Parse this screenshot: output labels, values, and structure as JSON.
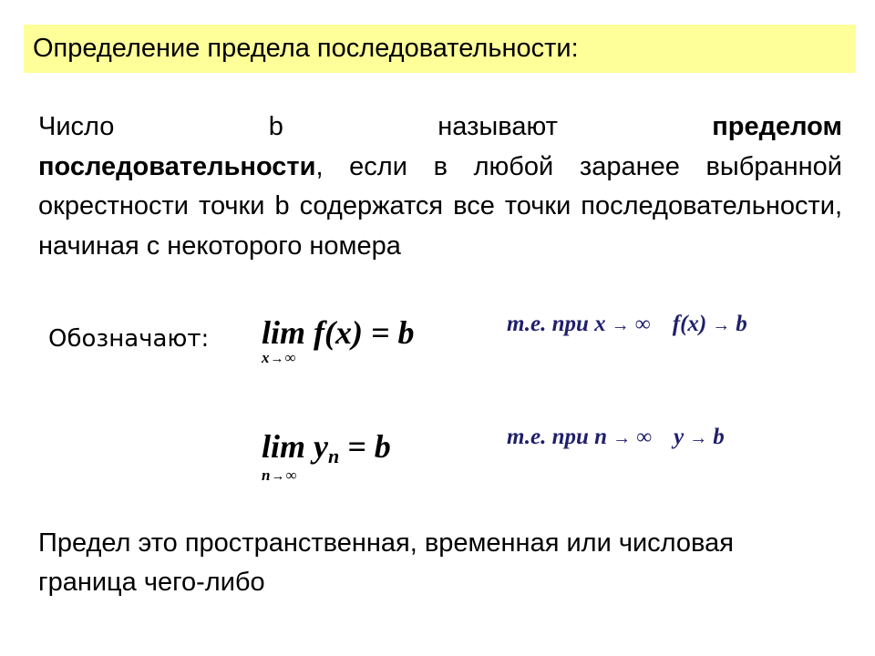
{
  "slide": {
    "title": "Определение предела последовательности:",
    "title_background": "#ffff99",
    "definition": {
      "line1": [
        "Число",
        "b",
        "называют",
        "пределом"
      ],
      "bold_term": "последовательности",
      "rest": ", если в любой заранее выбранной окрестности точки b содержатся все точки последовательности, начиная с некоторого номера"
    },
    "notation_label": "Обозначают:",
    "formulas": [
      {
        "lim": "lim",
        "expression": "f(x) = b",
        "under_var": "x",
        "under_arrow": "→",
        "under_target": "∞",
        "explanation": {
          "prefix": "т.е. при x",
          "arrow1": "→",
          "target1": "∞",
          "func": "f(x)",
          "arrow2": "→",
          "target2": "b"
        }
      },
      {
        "lim": "lim",
        "expression_var": "y",
        "expression_sub": "n",
        "expression_rest": " = b",
        "under_var": "n",
        "under_arrow": "→",
        "under_target": "∞",
        "explanation": {
          "prefix": "т.е. при n",
          "arrow1": "→",
          "target1": "∞",
          "func": "y",
          "arrow2": "→",
          "target2": "b"
        }
      }
    ],
    "explanation_color": "#1f1f6b",
    "conclusion": "Предел это пространственная, временная или числовая граница чего-либо"
  }
}
